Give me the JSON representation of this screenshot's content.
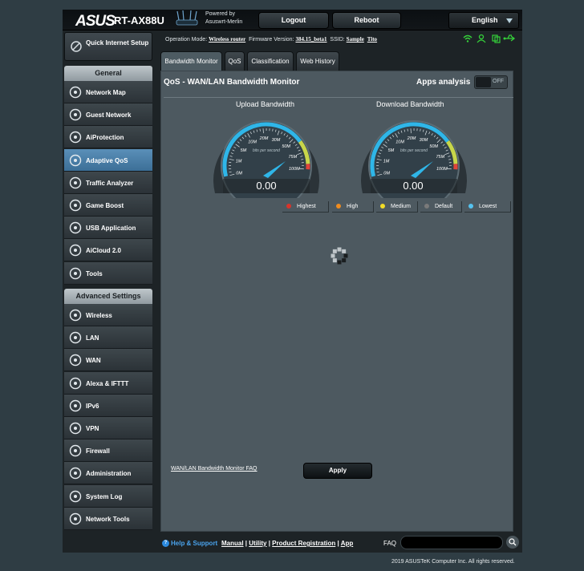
{
  "header": {
    "brand": "ASUS",
    "model": "RT-AX88U",
    "powered_line1": "Powered by",
    "powered_line2": "Asuswrt-Merlin",
    "logout": "Logout",
    "reboot": "Reboot",
    "language": "English"
  },
  "status": {
    "op_mode_label": "Operation Mode:",
    "op_mode": "Wireless router",
    "fw_label": "Firmware Version:",
    "fw": "384.15_beta1",
    "ssid_label": "SSID:",
    "ssid1": "Sample",
    "ssid2": "Tito"
  },
  "sidebar": {
    "quick_setup": "Quick Internet Setup",
    "general_header": "General",
    "general": [
      {
        "label": "Network Map",
        "icon": "network-map-icon"
      },
      {
        "label": "Guest Network",
        "icon": "globe-icon"
      },
      {
        "label": "AiProtection",
        "icon": "lock-icon"
      },
      {
        "label": "Adaptive QoS",
        "icon": "speedometer-icon",
        "active": true
      },
      {
        "label": "Traffic Analyzer",
        "icon": "traffic-icon"
      },
      {
        "label": "Game Boost",
        "icon": "gamepad-icon"
      },
      {
        "label": "USB Application",
        "icon": "usb-icon"
      },
      {
        "label": "AiCloud 2.0",
        "icon": "cloud-icon"
      },
      {
        "label": "Tools",
        "icon": "wrench-icon"
      }
    ],
    "advanced_header": "Advanced Settings",
    "advanced": [
      {
        "label": "Wireless",
        "icon": "wireless-icon"
      },
      {
        "label": "LAN",
        "icon": "lan-icon"
      },
      {
        "label": "WAN",
        "icon": "globe-icon"
      },
      {
        "label": "Alexa & IFTTT",
        "icon": "alexa-icon"
      },
      {
        "label": "IPv6",
        "icon": "ipv6-icon"
      },
      {
        "label": "VPN",
        "icon": "vpn-icon"
      },
      {
        "label": "Firewall",
        "icon": "flame-icon"
      },
      {
        "label": "Administration",
        "icon": "admin-icon"
      },
      {
        "label": "System Log",
        "icon": "log-icon"
      },
      {
        "label": "Network Tools",
        "icon": "gear-icon"
      }
    ]
  },
  "tabs": [
    "Bandwidth Monitor",
    "QoS",
    "Classification",
    "Web History"
  ],
  "main": {
    "title": "QoS - WAN/LAN Bandwidth Monitor",
    "apps_analysis": "Apps analysis",
    "toggle_state": "OFF",
    "upload_label": "Upload Bandwidth",
    "download_label": "Download Bandwidth",
    "upload_value": "0.00",
    "download_value": "0.00",
    "gauge_unit": "bits per second",
    "gauge_ticks": [
      "0M",
      "1M",
      "5M",
      "10M",
      "20M",
      "30M",
      "50M",
      "75M",
      "100M"
    ],
    "legend": [
      {
        "label": "Highest",
        "color": "#d8342a"
      },
      {
        "label": "High",
        "color": "#f08c1e"
      },
      {
        "label": "Medium",
        "color": "#f2dc28"
      },
      {
        "label": "Default",
        "color": "#7a7a7a"
      },
      {
        "label": "Lowest",
        "color": "#55c2ef"
      }
    ],
    "faq_link": "WAN/LAN Bandwidth Monitor FAQ",
    "apply": "Apply"
  },
  "footer": {
    "help": "Help & Support",
    "manual": "Manual",
    "utility": "Utility",
    "registration": "Product Registration",
    "app": "App",
    "faq": "FAQ",
    "copyright": "2019 ASUSTeK Computer Inc. All rights reserved."
  },
  "colors": {
    "accent_active": "#4a80ab",
    "status_green": "#35d13a",
    "gauge_blue": "#2fb6e8"
  }
}
